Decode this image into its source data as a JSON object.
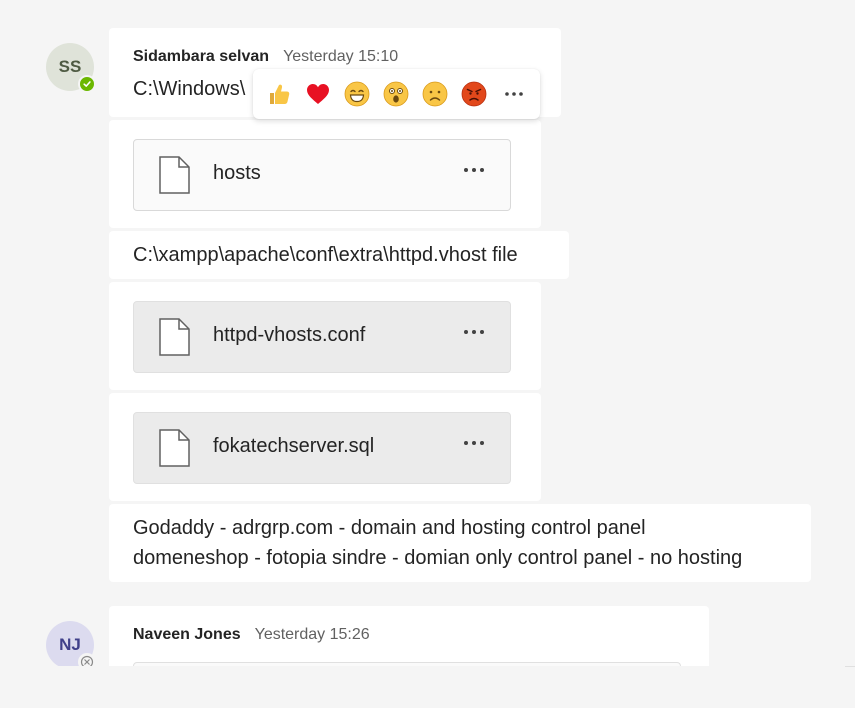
{
  "messages": [
    {
      "avatar_initials": "SS",
      "author": "Sidambara selvan",
      "time": "Yesterday 15:10",
      "text1": "C:\\Windows\\",
      "files": [
        "hosts",
        "httpd-vhosts.conf",
        "fokatechserver.sql"
      ],
      "text2": "C:\\xampp\\apache\\conf\\extra\\httpd.vhost file",
      "text3_line1": "Godaddy - adrgrp.com - domain and hosting control panel",
      "text3_line2": "domeneshop - fotopia sindre - domian only control panel - no hosting"
    },
    {
      "avatar_initials": "NJ",
      "author": "Naveen Jones",
      "time": "Yesterday 15:26"
    }
  ],
  "reactions": [
    "like-icon",
    "heart-icon",
    "laugh-icon",
    "surprised-icon",
    "sad-icon",
    "angry-icon",
    "more-options-icon"
  ],
  "colors": {
    "presence_available": "#6bb700",
    "heart": "#e81123",
    "angry": "#e2481b",
    "emoji": "#f9c646"
  }
}
